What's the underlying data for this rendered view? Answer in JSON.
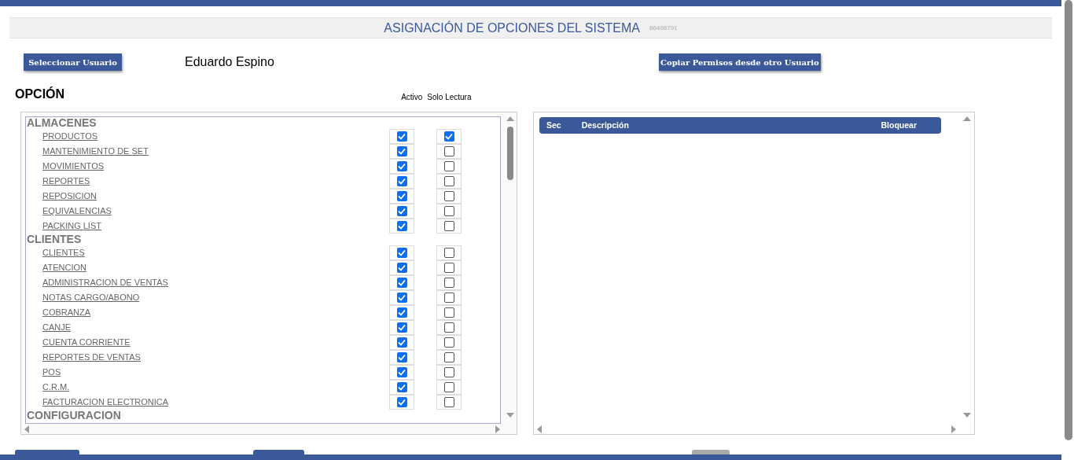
{
  "title": "ASIGNACIÓN DE OPCIONES DEL SISTEMA",
  "code": "86498791",
  "select_user_button": "Seleccionar Usuario",
  "user_name": "Eduardo Espino",
  "copy_button": "Copiar Permisos desde otro Usuario",
  "options_heading": "OPCIÓN",
  "columns": [
    "Activo",
    "Solo Lectura"
  ],
  "groups": [
    {
      "name": "ALMACENES",
      "items": [
        {
          "label": "PRODUCTOS",
          "active": true,
          "read_only": true
        },
        {
          "label": "MANTENIMIENTO DE SET",
          "active": true,
          "read_only": false
        },
        {
          "label": "MOVIMIENTOS",
          "active": true,
          "read_only": false
        },
        {
          "label": "REPORTES",
          "active": true,
          "read_only": false
        },
        {
          "label": "REPOSICION",
          "active": true,
          "read_only": false
        },
        {
          "label": "EQUIVALENCIAS",
          "active": true,
          "read_only": false
        },
        {
          "label": "PACKING LIST",
          "active": true,
          "read_only": false
        }
      ]
    },
    {
      "name": "CLIENTES",
      "items": [
        {
          "label": "CLIENTES",
          "active": true,
          "read_only": false
        },
        {
          "label": "ATENCION",
          "active": true,
          "read_only": false
        },
        {
          "label": "ADMINISTRACION DE VENTAS",
          "active": true,
          "read_only": false
        },
        {
          "label": "NOTAS CARGO/ABONO",
          "active": true,
          "read_only": false
        },
        {
          "label": "COBRANZA",
          "active": true,
          "read_only": false
        },
        {
          "label": "CANJE",
          "active": true,
          "read_only": false
        },
        {
          "label": "CUENTA CORRIENTE",
          "active": true,
          "read_only": false
        },
        {
          "label": "REPORTES DE VENTAS",
          "active": true,
          "read_only": false
        },
        {
          "label": "POS",
          "active": true,
          "read_only": false
        },
        {
          "label": "C.R.M.",
          "active": true,
          "read_only": false
        },
        {
          "label": "FACTURACION ELECTRONICA",
          "active": true,
          "read_only": false
        }
      ]
    },
    {
      "name": "CONFIGURACION"
    }
  ],
  "table": {
    "columns": [
      "Sec",
      "Descripción",
      "Bloquear"
    ]
  }
}
